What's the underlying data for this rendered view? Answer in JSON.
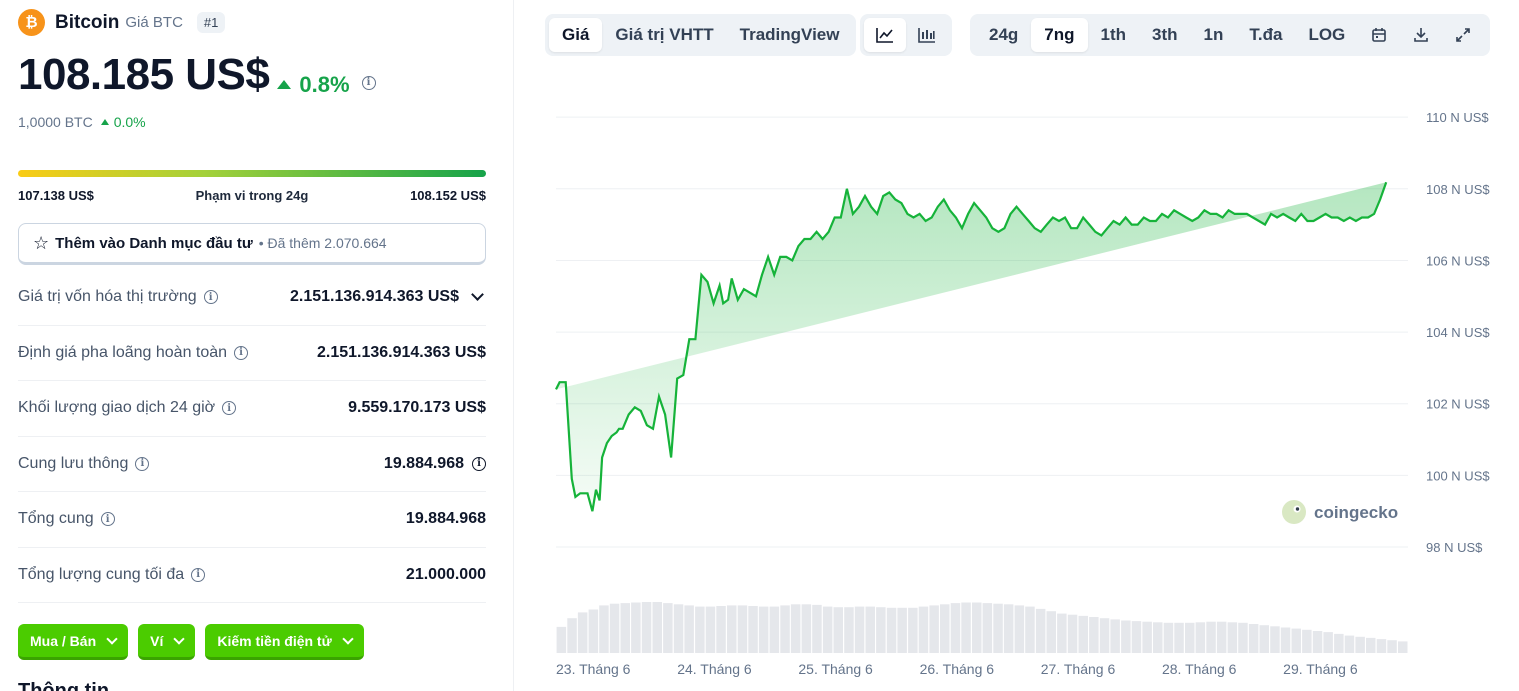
{
  "coin": {
    "name": "Bitcoin",
    "subtitle": "Giá BTC",
    "rank": "#1",
    "logo_glyph": "₿",
    "price": "108.185 US$",
    "change": "0.8%",
    "btc_value": "1,0000 BTC",
    "btc_change": "0.0%"
  },
  "range_24h": {
    "low": "107.138 US$",
    "label": "Phạm vi trong 24g",
    "high": "108.152 US$"
  },
  "watchlist": {
    "label": "Thêm vào Danh mục đầu tư",
    "added": "• Đã thêm 2.070.664"
  },
  "stats": [
    {
      "label": "Giá trị vốn hóa thị trường",
      "value": "2.151.136.914.363 US$"
    },
    {
      "label": "Định giá pha loãng hoàn toàn",
      "value": "2.151.136.914.363 US$"
    },
    {
      "label": "Khối lượng giao dịch 24 giờ",
      "value": "9.559.170.173 US$"
    },
    {
      "label": "Cung lưu thông",
      "value": "19.884.968"
    },
    {
      "label": "Tổng cung",
      "value": "19.884.968"
    },
    {
      "label": "Tổng lượng cung tối đa",
      "value": "21.000.000"
    }
  ],
  "actions": [
    "Mua / Bán",
    "Ví",
    "Kiếm tiền điện tử"
  ],
  "section_title_cut": "Thông tin",
  "toolbar": {
    "view_tabs": [
      "Giá",
      "Giá trị VHTT",
      "TradingView"
    ],
    "range_tabs": [
      "24g",
      "7ng",
      "1th",
      "3th",
      "1n",
      "T.đa",
      "LOG"
    ],
    "active_view": "Giá",
    "active_range": "7ng"
  },
  "watermark": "coingecko",
  "colors": {
    "accent_green": "#16a34a",
    "chart_line": "#16b33a",
    "button_green": "#4bcc00",
    "btc_orange": "#f7931a"
  },
  "chart_data": {
    "type": "area",
    "title": "",
    "xlabel": "",
    "ylabel": "",
    "y_tick_labels": [
      "110 N US$",
      "108 N US$",
      "106 N US$",
      "104 N US$",
      "102 N US$",
      "100 N US$",
      "98 N US$"
    ],
    "y_ticks": [
      110000,
      108000,
      106000,
      104000,
      102000,
      100000,
      98000
    ],
    "ylim": [
      98000,
      110200
    ],
    "x_tick_labels": [
      "23. Tháng 6",
      "24. Tháng 6",
      "25. Tháng 6",
      "26. Tháng 6",
      "27. Tháng 6",
      "28. Tháng 6",
      "29. Tháng 6"
    ],
    "x_tick_days": [
      0,
      1,
      2,
      3,
      4,
      5,
      6
    ],
    "x_range_days": [
      0,
      7.03
    ],
    "grid": true,
    "series": [
      {
        "price_points_days": [
          0.0,
          0.03,
          0.08,
          0.13,
          0.16,
          0.2,
          0.26,
          0.3,
          0.33,
          0.36,
          0.38,
          0.42,
          0.46,
          0.5,
          0.52,
          0.55,
          0.6,
          0.65,
          0.7,
          0.75,
          0.8,
          0.85,
          0.9,
          0.95,
          1.0,
          1.05,
          1.1,
          1.15,
          1.2,
          1.25,
          1.3,
          1.35,
          1.38,
          1.42,
          1.45,
          1.5,
          1.55,
          1.6,
          1.65,
          1.7,
          1.75,
          1.8,
          1.85,
          1.9,
          1.95,
          2.0,
          2.05,
          2.1,
          2.15,
          2.2,
          2.25,
          2.3,
          2.35,
          2.4,
          2.45,
          2.5,
          2.55,
          2.6,
          2.65,
          2.7,
          2.75,
          2.8,
          2.85,
          2.9,
          2.95,
          3.0,
          3.05,
          3.1,
          3.15,
          3.2,
          3.25,
          3.3,
          3.35,
          3.4,
          3.45,
          3.5,
          3.55,
          3.6,
          3.65,
          3.7,
          3.75,
          3.8,
          3.85,
          3.9,
          3.95,
          4.0,
          4.05,
          4.1,
          4.15,
          4.2,
          4.25,
          4.3,
          4.35,
          4.4,
          4.45,
          4.5,
          4.55,
          4.6,
          4.65,
          4.7,
          4.75,
          4.8,
          4.85,
          4.9,
          4.95,
          5.0,
          5.05,
          5.1,
          5.15,
          5.2,
          5.25,
          5.3,
          5.35,
          5.4,
          5.45,
          5.5,
          5.55,
          5.6,
          5.65,
          5.7,
          5.75,
          5.8,
          5.85,
          5.9,
          5.95,
          6.0,
          6.05,
          6.1,
          6.15,
          6.2,
          6.25,
          6.3,
          6.35,
          6.4,
          6.45,
          6.5,
          6.55,
          6.6,
          6.65,
          6.7,
          6.75,
          6.8,
          6.85,
          6.9,
          6.95,
          7.0,
          7.03
        ],
        "price_values": [
          102400,
          102600,
          102600,
          99900,
          99400,
          99500,
          99500,
          99000,
          99600,
          99300,
          100500,
          100900,
          101100,
          101200,
          101300,
          101300,
          101700,
          101900,
          101800,
          101400,
          101300,
          102200,
          101700,
          100500,
          102700,
          102800,
          103800,
          103800,
          105600,
          105400,
          104800,
          105300,
          104800,
          104900,
          105500,
          104900,
          105200,
          105100,
          105000,
          105600,
          106100,
          105600,
          106100,
          106100,
          106000,
          106400,
          106600,
          106600,
          106800,
          106600,
          106800,
          107200,
          107200,
          108000,
          107300,
          107500,
          107800,
          107500,
          107300,
          107800,
          107900,
          107700,
          107600,
          107300,
          107200,
          107300,
          107100,
          107200,
          107500,
          107700,
          107400,
          107200,
          106900,
          107300,
          107600,
          107400,
          107200,
          106900,
          106800,
          106900,
          107300,
          107500,
          107300,
          107100,
          106900,
          106800,
          107000,
          107200,
          107100,
          107200,
          106900,
          106900,
          107200,
          107000,
          106800,
          106700,
          106900,
          107100,
          107000,
          107200,
          107000,
          107000,
          107200,
          107100,
          107100,
          107300,
          107200,
          107400,
          107300,
          107200,
          107100,
          107200,
          107400,
          107300,
          107300,
          107200,
          107400,
          107300,
          107300,
          107300,
          107200,
          107100,
          107000,
          107300,
          107200,
          107300,
          107200,
          107100,
          107300,
          107100,
          107100,
          107200,
          107300,
          107200,
          107200,
          107100,
          107200,
          107100,
          107200,
          107200,
          107300,
          107700,
          108185
        ]
      }
    ],
    "volume_relative": [
      0.45,
      0.6,
      0.7,
      0.75,
      0.82,
      0.85,
      0.86,
      0.87,
      0.88,
      0.88,
      0.86,
      0.84,
      0.82,
      0.8,
      0.8,
      0.81,
      0.82,
      0.82,
      0.81,
      0.8,
      0.8,
      0.82,
      0.84,
      0.84,
      0.83,
      0.8,
      0.79,
      0.79,
      0.8,
      0.8,
      0.79,
      0.78,
      0.78,
      0.78,
      0.8,
      0.82,
      0.84,
      0.86,
      0.87,
      0.87,
      0.86,
      0.85,
      0.84,
      0.82,
      0.8,
      0.76,
      0.72,
      0.68,
      0.66,
      0.64,
      0.62,
      0.6,
      0.58,
      0.56,
      0.55,
      0.54,
      0.53,
      0.52,
      0.52,
      0.52,
      0.53,
      0.54,
      0.54,
      0.53,
      0.52,
      0.5,
      0.48,
      0.46,
      0.44,
      0.42,
      0.4,
      0.38,
      0.36,
      0.33,
      0.3,
      0.28,
      0.26,
      0.24,
      0.22,
      0.2
    ]
  }
}
